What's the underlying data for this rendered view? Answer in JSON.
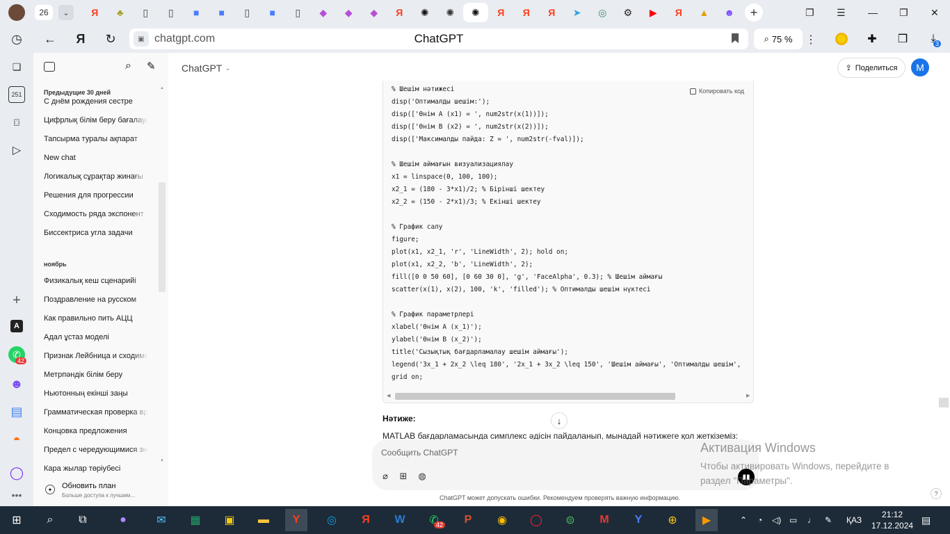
{
  "browser": {
    "tab_count": "26",
    "url": "chatgpt.com",
    "page_title": "ChatGPT",
    "zoom_level": "75 %",
    "downloads_badge": "3"
  },
  "tab_icons": [
    {
      "glyph": "Я",
      "color": "#fc3f1d"
    },
    {
      "glyph": "♣",
      "color": "#a6a32a"
    },
    {
      "glyph": "▯",
      "color": "#444444"
    },
    {
      "glyph": "▯",
      "color": "#444444"
    },
    {
      "glyph": "■",
      "color": "#4a7dff"
    },
    {
      "glyph": "■",
      "color": "#4a7dff"
    },
    {
      "glyph": "▯",
      "color": "#444444"
    },
    {
      "glyph": "■",
      "color": "#4a7dff"
    },
    {
      "glyph": "▯",
      "color": "#444444"
    },
    {
      "glyph": "◆",
      "color": "#b44fd6"
    },
    {
      "glyph": "◆",
      "color": "#b44fd6"
    },
    {
      "glyph": "◆",
      "color": "#b44fd6"
    },
    {
      "glyph": "Я",
      "color": "#fc3f1d"
    },
    {
      "glyph": "✺",
      "color": "#111111"
    },
    {
      "glyph": "✺",
      "color": "#333333"
    },
    {
      "glyph": "✺",
      "color": "#111111"
    },
    {
      "glyph": "Я",
      "color": "#fc3f1d"
    },
    {
      "glyph": "Я",
      "color": "#fc3f1d"
    },
    {
      "glyph": "Я",
      "color": "#fc3f1d"
    },
    {
      "glyph": "➤",
      "color": "#2aa3e0"
    },
    {
      "glyph": "◎",
      "color": "#3a8a6a"
    },
    {
      "glyph": "⚙",
      "color": "#222222"
    },
    {
      "glyph": "▶",
      "color": "#ff0000"
    },
    {
      "glyph": "Я",
      "color": "#fc3f1d"
    },
    {
      "glyph": "▲",
      "color": "#e0a000"
    },
    {
      "glyph": "☻",
      "color": "#7c4dff"
    }
  ],
  "sidebar": {
    "section_recent": "Предыдущие 30 дней",
    "items_recent": [
      "С днём рождения сестре",
      "Цифрлық білім беру бағалауы",
      "Тапсырма туралы ақпарат",
      "New chat",
      "Логикалық сұрақтар жинағы",
      "Решения для прогрессии",
      "Сходимость ряда экспонент",
      "Биссектриса угла задачи"
    ],
    "section_month": "ноябрь",
    "items_month": [
      "Физикалық кеш сценарийі",
      "Поздравление на русском",
      "Как правильно пить АЦЦ",
      "Адал ұстаз моделі",
      "Признак Лейбница и сходимость",
      "Метрпәндік білім беру",
      "Ньютонның екінші заңы",
      "Грамматическая проверка вр",
      "Концовка предложения",
      "Предел с чередующимися зна",
      "Кара жылар төріубесі"
    ],
    "upgrade_title": "Обновить план",
    "upgrade_sub": "Больше доступа к лучшим..."
  },
  "header": {
    "model": "ChatGPT",
    "share_label": "Поделиться",
    "avatar_letter": "M"
  },
  "code": {
    "copy_label": "Копировать код",
    "lines": [
      "% Шешім нәтижесі",
      "disp('Оптималды шешім:');",
      "disp(['Өнім A (x1) = ', num2str(x(1))]);",
      "disp(['Өнім B (x2) = ', num2str(x(2))]);",
      "disp(['Максималды пайда: Z = ', num2str(-fval)]);",
      "",
      "% Шешім аймағын визуализациялау",
      "x1 = linspace(0, 100, 100);",
      "x2_1 = (180 - 3*x1)/2; % Бірінші шектеу",
      "x2_2 = (150 - 2*x1)/3; % Екінші шектеу",
      "",
      "% График салу",
      "figure;",
      "plot(x1, x2_1, 'r', 'LineWidth', 2); hold on;",
      "plot(x1, x2_2, 'b', 'LineWidth', 2);",
      "fill([0 0 50 60], [0 60 30 0], 'g', 'FaceAlpha', 0.3); % Шешім аймағы",
      "scatter(x(1), x(2), 100, 'k', 'filled'); % Оптималды шешім нүктесі",
      "",
      "% График параметрлері",
      "xlabel('Өнім A (x_1)');",
      "ylabel('Өнім B (x_2)');",
      "title('Сызықтық бағдарламалау шешім аймағы');",
      "legend('3x_1 + 2x_2 \\leq 180', '2x_1 + 3x_2 \\leq 150', 'Шешім аймағы', 'Оптималды шешім',",
      "grid on;"
    ]
  },
  "response": {
    "heading": "Нәтиже:",
    "text": "MATLAB бағдарламасында симплекс әдісін пайдаланып, мынадай нәтижеге қол жеткіземіз:"
  },
  "composer": {
    "placeholder": "Сообщить ChatGPT",
    "disclaimer": "ChatGPT может допускать ошибки. Рекомендуем проверять важную информацию.",
    "help": "?"
  },
  "watermark": {
    "line1": "Активация Windows",
    "line2": "Чтобы активировать Windows, перейдите в раздел \"Параметры\"."
  },
  "browser_sidebar": {
    "badge_251": "251",
    "whatsapp_badge": "42",
    "letter_a": "A"
  },
  "taskbar": {
    "language": "ҚАЗ",
    "time": "21:12",
    "date": "17.12.2024",
    "whatsapp_badge": "42"
  }
}
